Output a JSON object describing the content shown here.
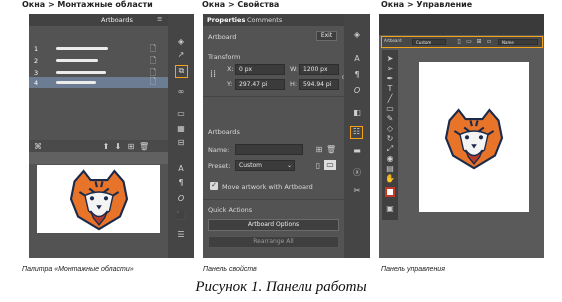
{
  "headers": [
    "Окна > Монтажные области",
    "Окна > Свойства",
    "Окна > Управление"
  ],
  "captions": [
    "Палитра «Монтажные области»",
    "Панель свойств",
    "Панель управления"
  ],
  "figure_caption": "Рисунок 1. Панели работы",
  "artboards_panel": {
    "tab": "Artboards",
    "menu_glyph": "≡",
    "rows": [
      {
        "num": "1"
      },
      {
        "num": "2"
      },
      {
        "num": "3"
      },
      {
        "num": "4"
      }
    ]
  },
  "properties_panel": {
    "tabs": [
      "Properties",
      "Comments"
    ],
    "section_title": "Artboard",
    "exit_label": "Exit",
    "transform_title": "Transform",
    "x_label": "X:",
    "x_value": "0 px",
    "y_label": "Y:",
    "y_value": "297.47 pi",
    "w_label": "W:",
    "w_value": "1200 px",
    "h_label": "H:",
    "h_value": "594.94 pi",
    "artboards_title": "Artboards",
    "name_label": "Name:",
    "preset_label": "Preset:",
    "preset_value": "Custom",
    "move_artwork_label": "Move artwork with Artboard",
    "quick_actions_title": "Quick Actions",
    "artboard_options_label": "Artboard Options",
    "rearrange_label": "Rearrange All"
  },
  "control_panel": {
    "artboard_label": "Artboard",
    "preset_value": "Custom",
    "name_value": "Name"
  },
  "colors": {
    "accent": "#f5a21b",
    "panel": "#535353",
    "dark": "#3a3a3a"
  }
}
